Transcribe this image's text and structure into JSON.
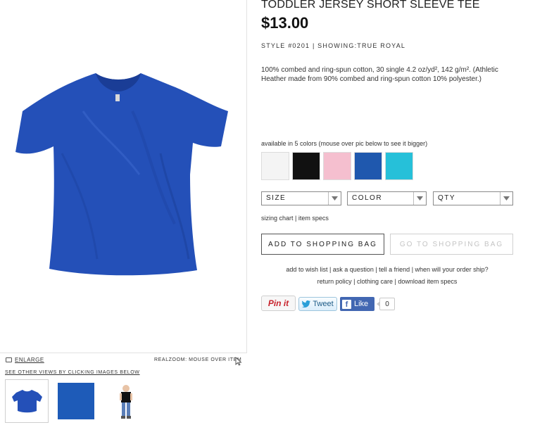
{
  "product": {
    "title": "TODDLER JERSEY SHORT SLEEVE TEE",
    "price": "$13.00",
    "style_line": "STYLE #0201 | SHOWING:TRUE ROYAL",
    "description": "100% combed and ring-spun cotton, 30 single 4.2 oz/yd², 142 g/m². (Athletic Heather made from 90% combed and ring-spun cotton 10% polyester.)"
  },
  "colors": {
    "available_text": "available in 5 colors (mouse over pic below to see it bigger)",
    "swatches": [
      {
        "name": "white",
        "hex": "#f4f4f4"
      },
      {
        "name": "black",
        "hex": "#111111"
      },
      {
        "name": "pink",
        "hex": "#f5bfcf"
      },
      {
        "name": "true royal",
        "hex": "#1f58ae"
      },
      {
        "name": "turquoise",
        "hex": "#26c0d9"
      }
    ]
  },
  "selects": {
    "size": "SIZE",
    "color": "COLOR",
    "qty": "QTY"
  },
  "small_links": "sizing chart | item specs",
  "buttons": {
    "add": "ADD TO SHOPPING BAG",
    "go": "GO TO SHOPPING BAG"
  },
  "links_row_1": "add to wish list | ask a question | tell a friend | when will your order ship?",
  "links_row_2": "return policy | clothing care | download item specs",
  "social": {
    "pinit": "Pin it",
    "tweet": "Tweet",
    "like": "Like",
    "like_count": "0"
  },
  "image_area": {
    "enlarge": "ENLARGE",
    "realzoom": "REALZOOM: MOUSE OVER ITEM",
    "see_views": "SEE OTHER VIEWS BY CLICKING IMAGES BELOW"
  },
  "colors_theme": {
    "shirt_blue": "#2450b8",
    "shirt_shadow": "#1a3d96"
  }
}
